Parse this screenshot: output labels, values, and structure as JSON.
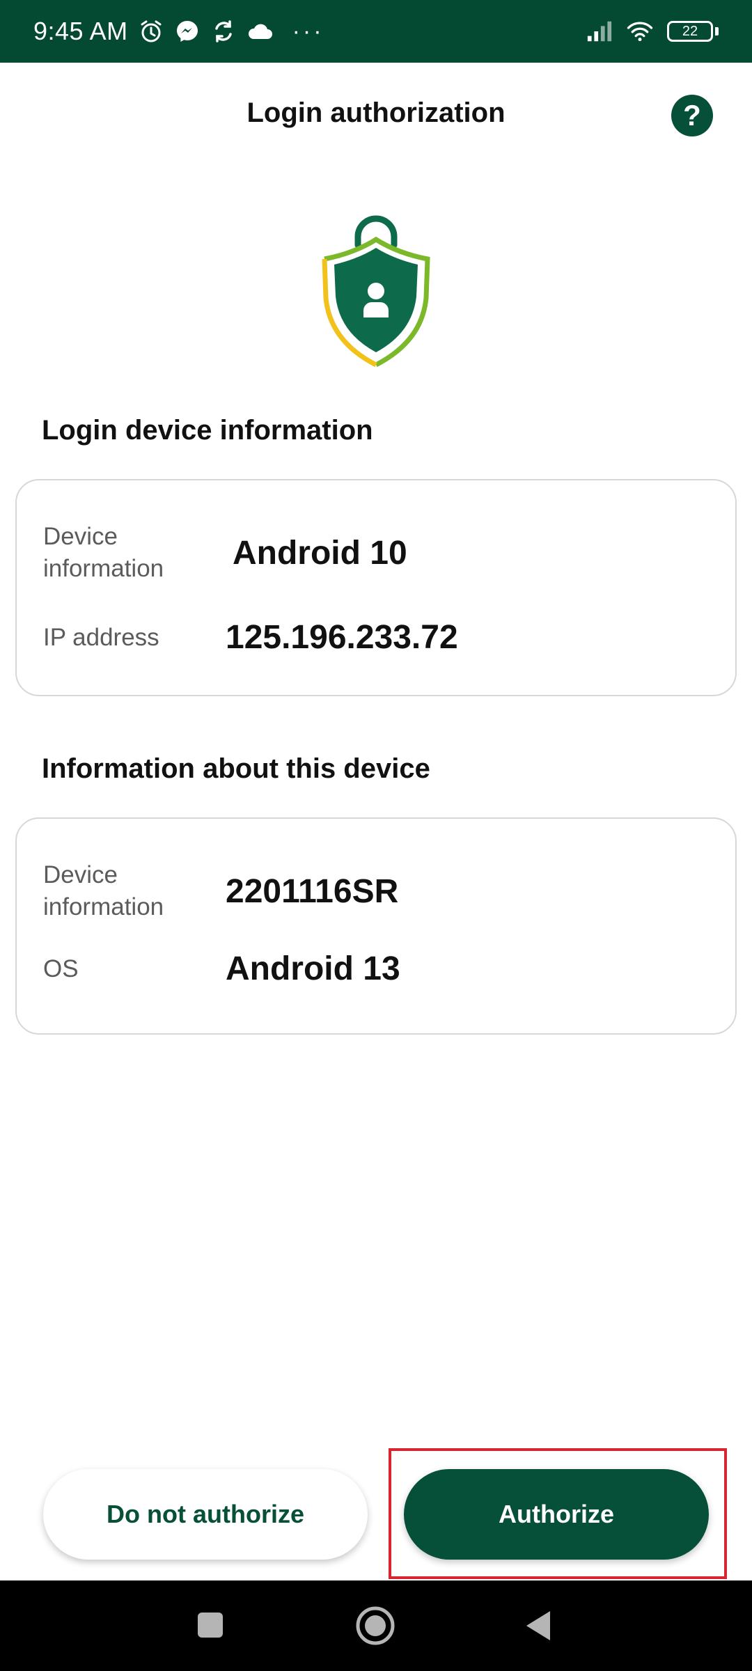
{
  "status_bar": {
    "time": "9:45 AM",
    "icons": [
      "alarm-icon",
      "messenger-icon",
      "sync-icon",
      "cloud-icon"
    ],
    "more": "···",
    "battery_level": "22"
  },
  "header": {
    "title": "Login authorization",
    "help_label": "?"
  },
  "login_device": {
    "title": "Login device information",
    "rows": [
      {
        "label": "Device information",
        "value": "Android 10"
      },
      {
        "label": "IP address",
        "value": "125.196.233.72"
      }
    ]
  },
  "this_device": {
    "title": "Information about this device",
    "rows": [
      {
        "label": "Device information",
        "value": "2201116SR"
      },
      {
        "label": "OS",
        "value": "Android 13"
      }
    ]
  },
  "actions": {
    "deny_label": "Do not authorize",
    "authorize_label": "Authorize"
  },
  "colors": {
    "primary": "#064f38",
    "status_bar": "#044a33",
    "shield_yellow": "#f2c21b",
    "shield_green": "#7bb82a",
    "highlight": "#d9252f"
  }
}
